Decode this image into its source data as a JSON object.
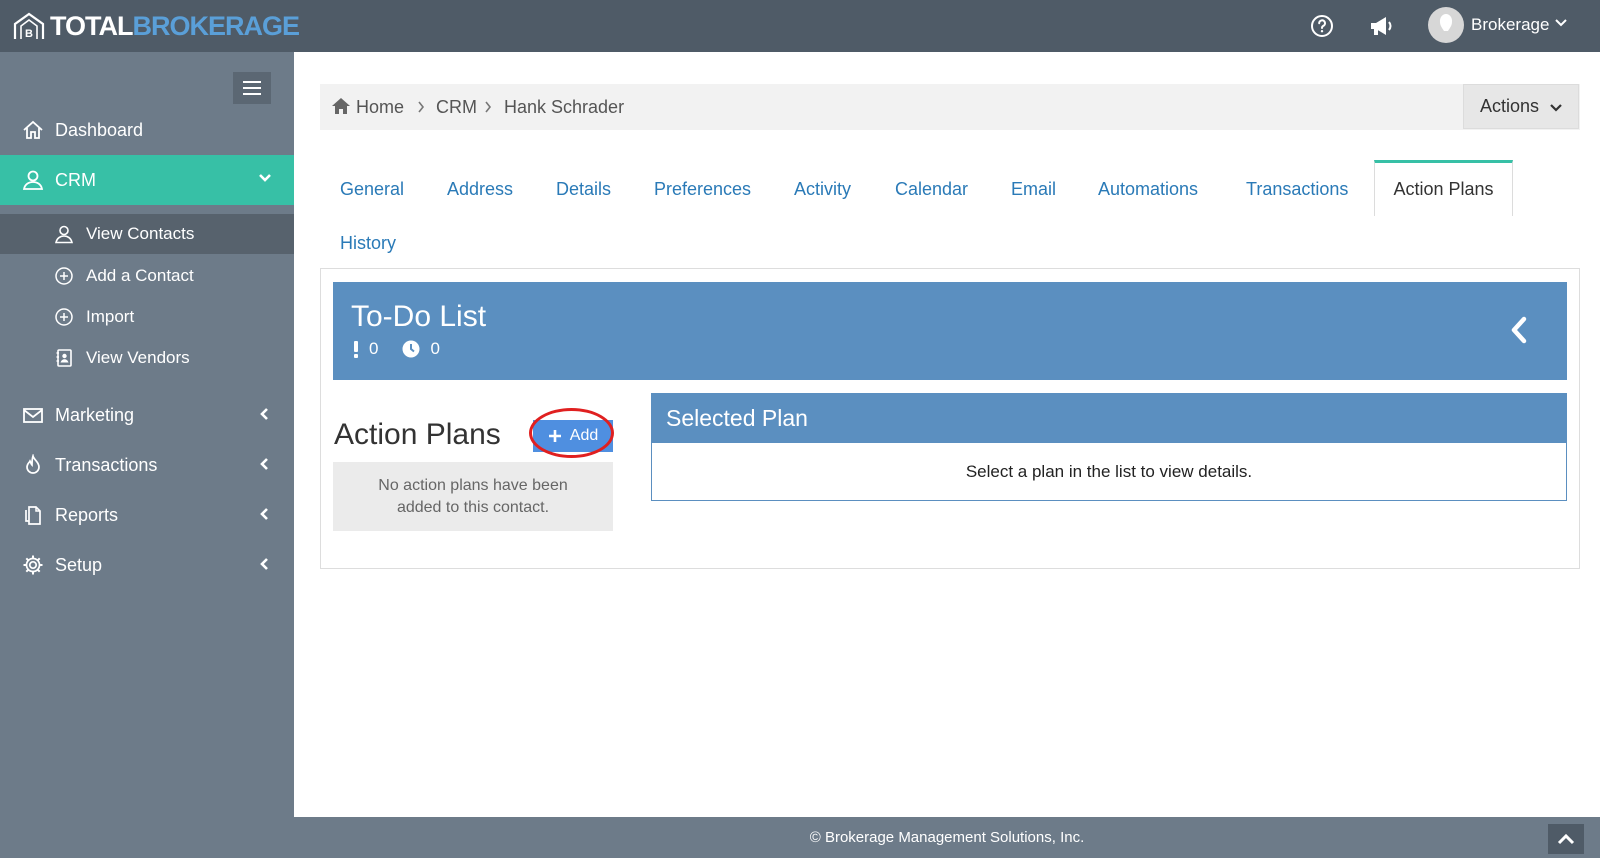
{
  "brand": {
    "part1": "TOTAL",
    "part2": "BROKERAGE"
  },
  "topbar": {
    "user_label": "Brokerage",
    "icons": [
      "help-icon",
      "megaphone-icon",
      "avatar"
    ]
  },
  "sidebar": {
    "items": [
      {
        "label": "Dashboard",
        "icon": "home-icon"
      },
      {
        "label": "CRM",
        "icon": "user-icon",
        "active": true
      },
      {
        "label": "Marketing",
        "icon": "envelope-icon"
      },
      {
        "label": "Transactions",
        "icon": "fire-icon"
      },
      {
        "label": "Reports",
        "icon": "document-icon"
      },
      {
        "label": "Setup",
        "icon": "gear-icon"
      }
    ],
    "crm_sub": [
      {
        "label": "View Contacts",
        "icon": "user-outline-icon",
        "active": true
      },
      {
        "label": "Add a Contact",
        "icon": "plus-circle-icon"
      },
      {
        "label": "Import",
        "icon": "plus-circle-icon"
      },
      {
        "label": "View Vendors",
        "icon": "address-book-icon"
      }
    ]
  },
  "breadcrumb": [
    "Home",
    "CRM",
    "Hank Schrader"
  ],
  "actions_label": "Actions",
  "tabs": [
    "General",
    "Address",
    "Details",
    "Preferences",
    "Activity",
    "Calendar",
    "Email",
    "Automations",
    "Transactions",
    "Action Plans",
    "History"
  ],
  "active_tab": "Action Plans",
  "todo": {
    "title": "To-Do List",
    "urgent_count": "0",
    "pending_count": "0"
  },
  "action_plans": {
    "title": "Action Plans",
    "add_label": "Add",
    "empty_message": "No action plans have been added to this contact."
  },
  "selected_plan": {
    "title": "Selected Plan",
    "message": "Select a plan in the list to view details."
  },
  "footer": "© Brokerage Management Solutions, Inc.",
  "colors": {
    "topbar": "#4f5b67",
    "sidebar": "#6d7b89",
    "accent": "#37c0a6",
    "panel_blue": "#5b8fc0",
    "link": "#2a7ab7",
    "add_button": "#4f8fe0",
    "highlight_ring": "#e02020"
  }
}
